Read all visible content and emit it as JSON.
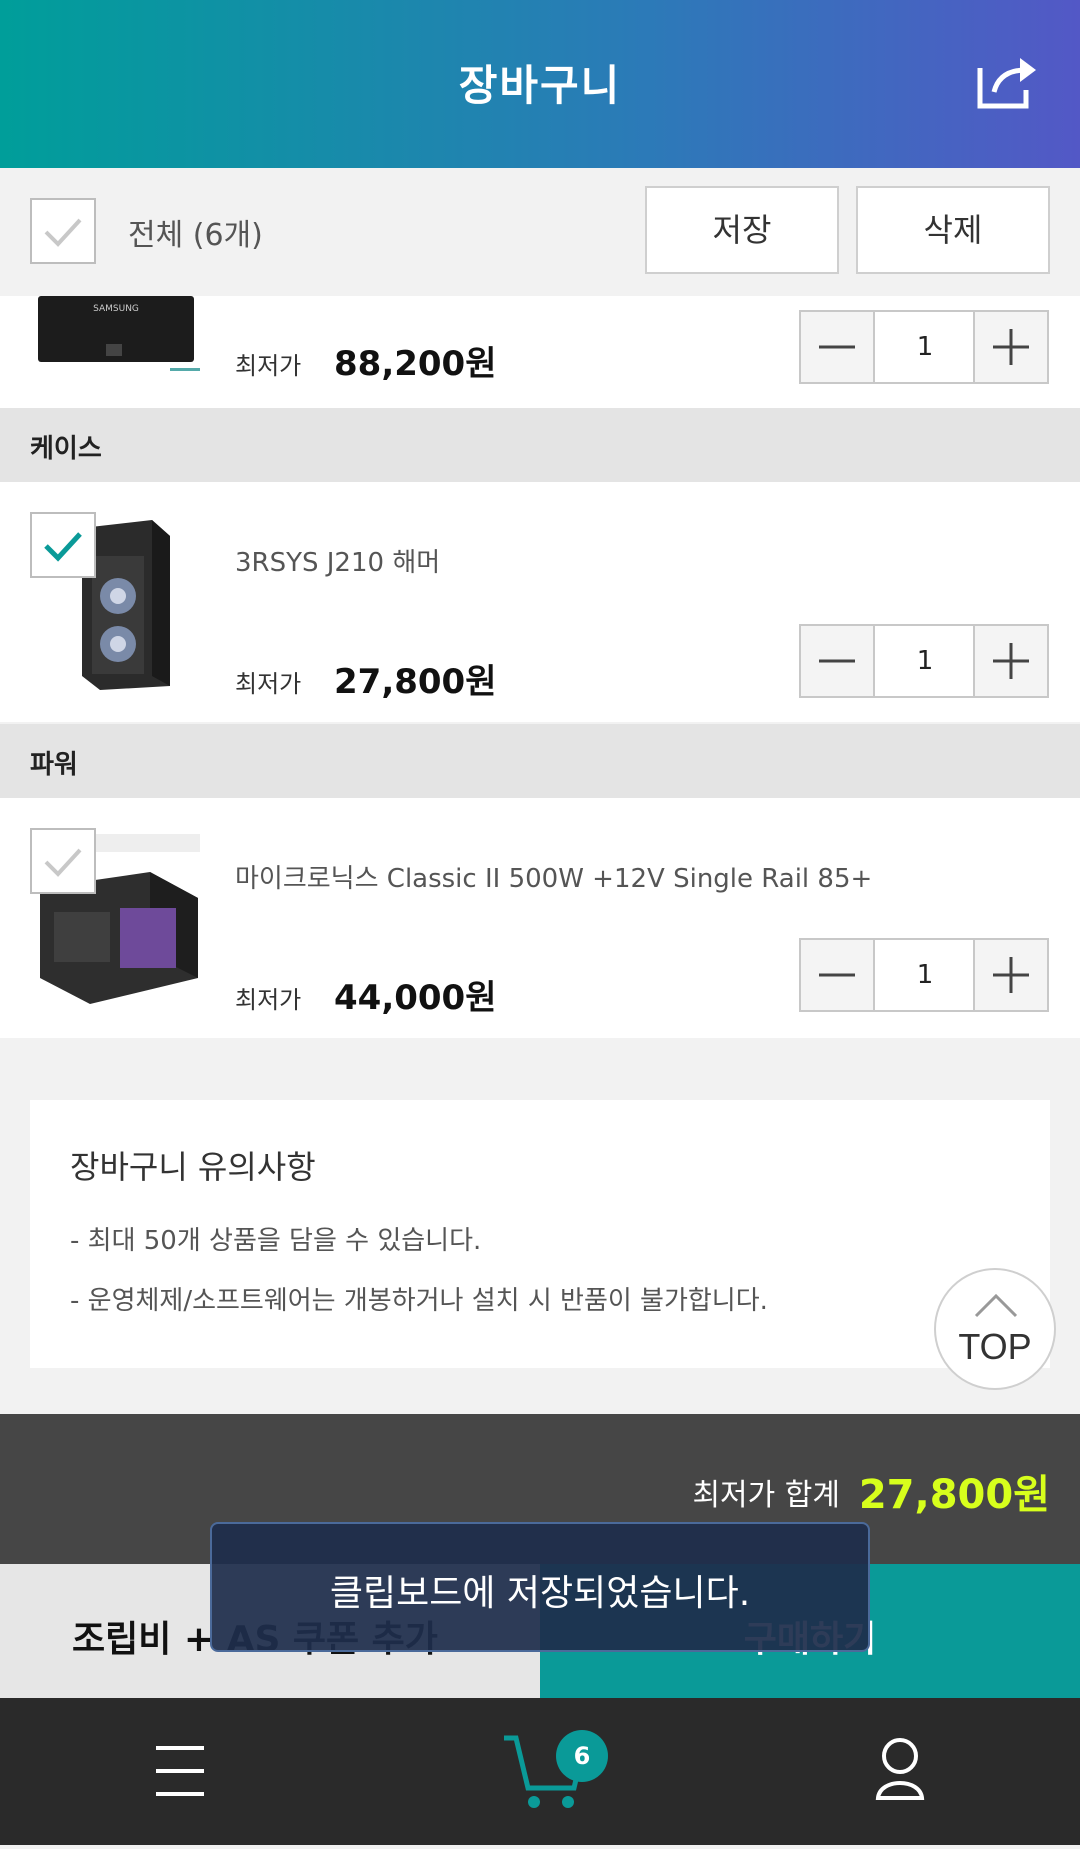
{
  "header": {
    "title": "장바구니",
    "share_icon": "share-icon"
  },
  "selection": {
    "all_label": "전체 (6개)",
    "save_label": "저장",
    "delete_label": "삭제"
  },
  "items": [
    {
      "category": "",
      "name": "",
      "price_label": "최저가",
      "price": "88,200원",
      "quantity": "1",
      "checked": false
    },
    {
      "category": "케이스",
      "name": "3RSYS J210 해머",
      "price_label": "최저가",
      "price": "27,800원",
      "quantity": "1",
      "checked": true
    },
    {
      "category": "파워",
      "name": "마이크로닉스 Classic II 500W +12V Single Rail 85+",
      "price_label": "최저가",
      "price": "44,000원",
      "quantity": "1",
      "checked": false
    }
  ],
  "thumb_labels": {
    "ssd_brand": "SAMSUNG"
  },
  "notice": {
    "title": "장바구니 유의사항",
    "lines": [
      "- 최대 50개 상품을 담을 수 있습니다.",
      "- 운영체제/소프트웨어는 개봉하거나 설치 시 반품이 불가합니다."
    ]
  },
  "top_button": {
    "label": "TOP"
  },
  "total": {
    "label": "최저가 합계",
    "value": "27,800원"
  },
  "actions": {
    "coupon_label": "조립비 + AS 쿠폰 추가",
    "buy_label": "구매하기"
  },
  "toast": {
    "message": "클립보드에 저장되었습니다."
  },
  "bottom_nav": {
    "cart_badge": "6"
  },
  "colors": {
    "accent": "#0a9a98",
    "total_price": "#d7ff1c",
    "header_start": "#009e9a",
    "header_end": "#5358c6"
  }
}
